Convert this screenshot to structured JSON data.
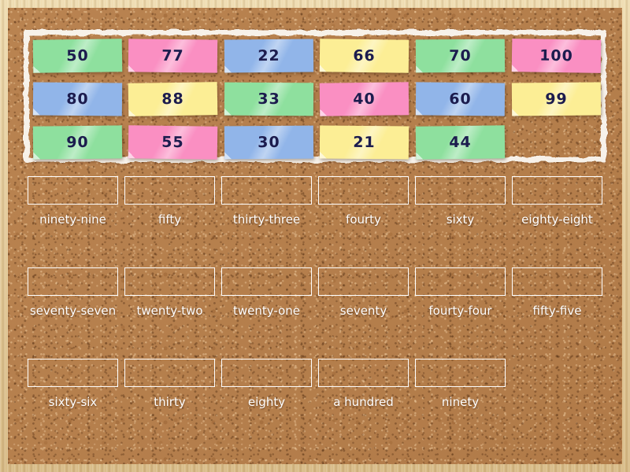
{
  "activity": {
    "type": "match-up",
    "board_background": "cork",
    "frame_color": "#e4cb9a",
    "cork_color": "#b67f4c"
  },
  "palette": {
    "green": "#8ee09e",
    "pink": "#fa8fc2",
    "blue": "#91b5e9",
    "yellow": "#fcee95",
    "text": "#1c1c4e",
    "slot_border": "#ffffff",
    "label_text": "#ffffff"
  },
  "tray": {
    "name": "tile-tray",
    "tiles": [
      [
        {
          "value": "50",
          "color": "green",
          "tilt": -0.8
        },
        {
          "value": "77",
          "color": "pink",
          "tilt": 0.6
        },
        {
          "value": "22",
          "color": "blue",
          "tilt": -0.5
        },
        {
          "value": "66",
          "color": "yellow",
          "tilt": 0.7
        },
        {
          "value": "70",
          "color": "green",
          "tilt": -0.4
        },
        {
          "value": "100",
          "color": "pink",
          "tilt": 0.9
        }
      ],
      [
        {
          "value": "80",
          "color": "blue",
          "tilt": 0.5
        },
        {
          "value": "88",
          "color": "yellow",
          "tilt": -0.9
        },
        {
          "value": "33",
          "color": "green",
          "tilt": 0.4
        },
        {
          "value": "40",
          "color": "pink",
          "tilt": -0.7
        },
        {
          "value": "60",
          "color": "blue",
          "tilt": 0.6
        },
        {
          "value": "99",
          "color": "yellow",
          "tilt": -0.5
        }
      ],
      [
        {
          "value": "90",
          "color": "green",
          "tilt": -0.6
        },
        {
          "value": "55",
          "color": "pink",
          "tilt": 0.8
        },
        {
          "value": "30",
          "color": "blue",
          "tilt": -0.4
        },
        {
          "value": "21",
          "color": "yellow",
          "tilt": 0.5
        },
        {
          "value": "44",
          "color": "green",
          "tilt": -0.7
        }
      ]
    ]
  },
  "answers": {
    "name": "answer-slots",
    "rows": [
      [
        {
          "label": "ninety-nine",
          "filled": false
        },
        {
          "label": "fifty",
          "filled": false
        },
        {
          "label": "thirty-three",
          "filled": false
        },
        {
          "label": "fourty",
          "filled": false
        },
        {
          "label": "sixty",
          "filled": false
        },
        {
          "label": "eighty-eight",
          "filled": false
        }
      ],
      [
        {
          "label": "seventy-seven",
          "filled": false
        },
        {
          "label": "twenty-two",
          "filled": false
        },
        {
          "label": "twenty-one",
          "filled": false
        },
        {
          "label": "seventy",
          "filled": false
        },
        {
          "label": "fourty-four",
          "filled": false
        },
        {
          "label": "fifty-five",
          "filled": false
        }
      ],
      [
        {
          "label": "sixty-six",
          "filled": false
        },
        {
          "label": "thirty",
          "filled": false
        },
        {
          "label": "eighty",
          "filled": false
        },
        {
          "label": "a hundred",
          "filled": false
        },
        {
          "label": "ninety",
          "filled": false
        }
      ]
    ]
  }
}
